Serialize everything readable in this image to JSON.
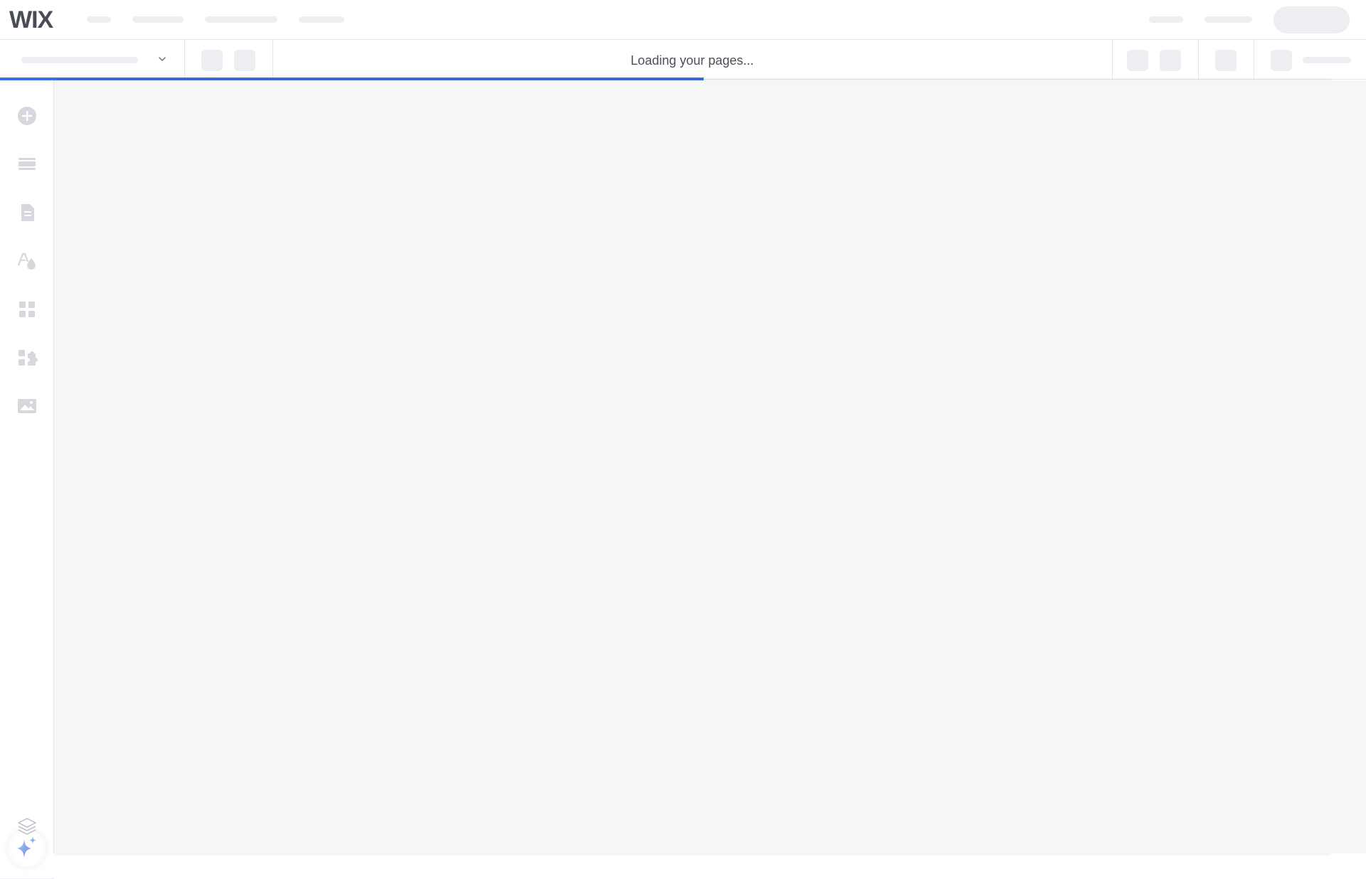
{
  "app": {
    "logo_text": "WIX"
  },
  "toolbar": {
    "status_text": "Loading your pages..."
  },
  "progress": {
    "fraction": 0.515,
    "color": "#3b6fe0"
  },
  "sidebar": {
    "items": [
      {
        "icon": "add-icon"
      },
      {
        "icon": "sections-icon"
      },
      {
        "icon": "pages-icon"
      },
      {
        "icon": "design-icon"
      },
      {
        "icon": "apps-icon"
      },
      {
        "icon": "business-tools-icon"
      },
      {
        "icon": "media-icon"
      }
    ],
    "ai_button_icon": "sparkle-icon",
    "layers_icon": "layers-icon"
  },
  "colors": {
    "skeleton": "#eceef1",
    "canvas": "#f5f6f8",
    "icon": "#d6d8dd"
  }
}
